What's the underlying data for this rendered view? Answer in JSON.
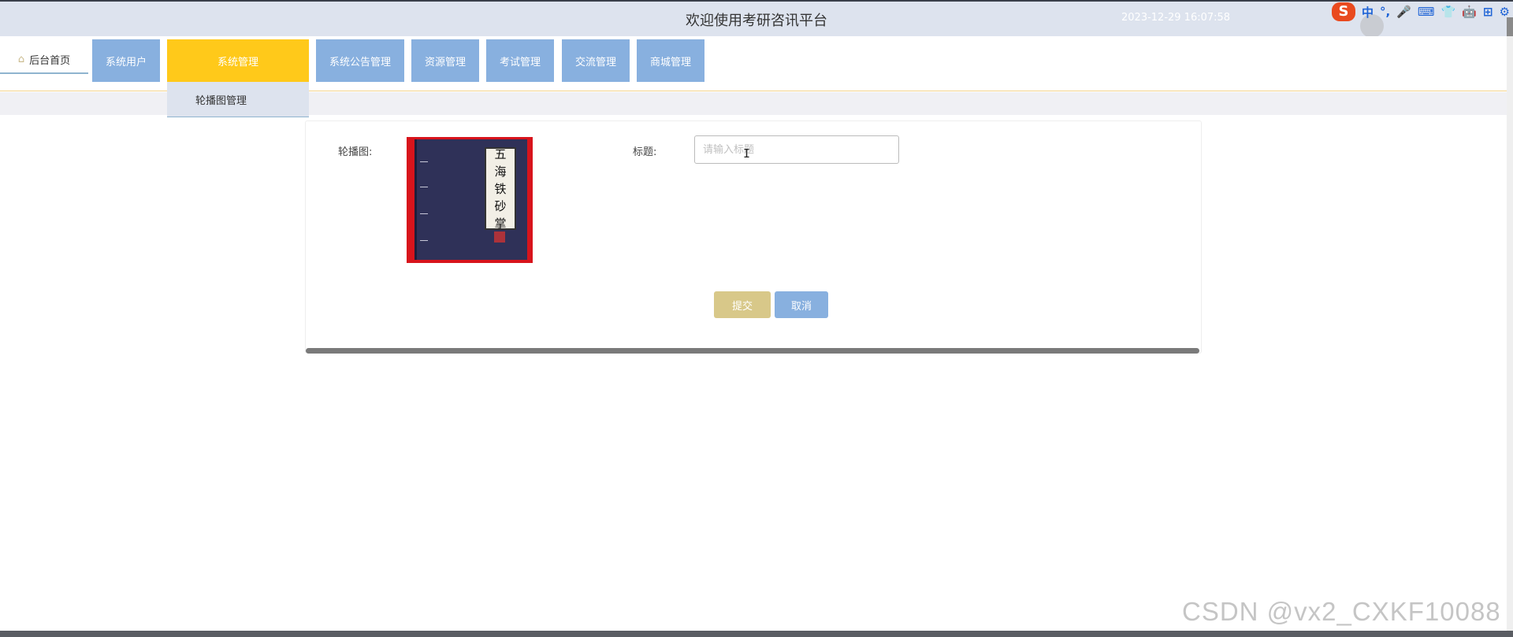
{
  "header": {
    "title": "欢迎使用考研咨讯平台",
    "datetime": "2023-12-29 16:07:58"
  },
  "ime_toolbar": {
    "items": [
      "S",
      "中",
      "°,",
      "🎤",
      "⌨",
      "👕",
      "🤖",
      "⊞",
      "⚙"
    ]
  },
  "nav": {
    "home_label": "后台首页",
    "items": [
      {
        "label": "系统用户"
      },
      {
        "label": "系统管理",
        "active": true
      },
      {
        "label": "系统公告管理"
      },
      {
        "label": "资源管理"
      },
      {
        "label": "考试管理"
      },
      {
        "label": "交流管理"
      },
      {
        "label": "商城管理"
      }
    ],
    "dropdown": {
      "label": "轮播图管理"
    }
  },
  "form": {
    "image_label": "轮播图:",
    "book_title_chars": [
      "五",
      "海",
      "铁",
      "砂",
      "掌"
    ],
    "title_label": "标题:",
    "title_value": "",
    "title_placeholder": "请输入标题",
    "submit_label": "提交",
    "cancel_label": "取消"
  },
  "watermark": "CSDN @vx2_CXKF10088",
  "colors": {
    "header_bg": "#dde3ee",
    "nav_item": "#88b0df",
    "nav_active": "#ffc91a",
    "submit": "#d8c889",
    "cancel": "#88b0df"
  }
}
